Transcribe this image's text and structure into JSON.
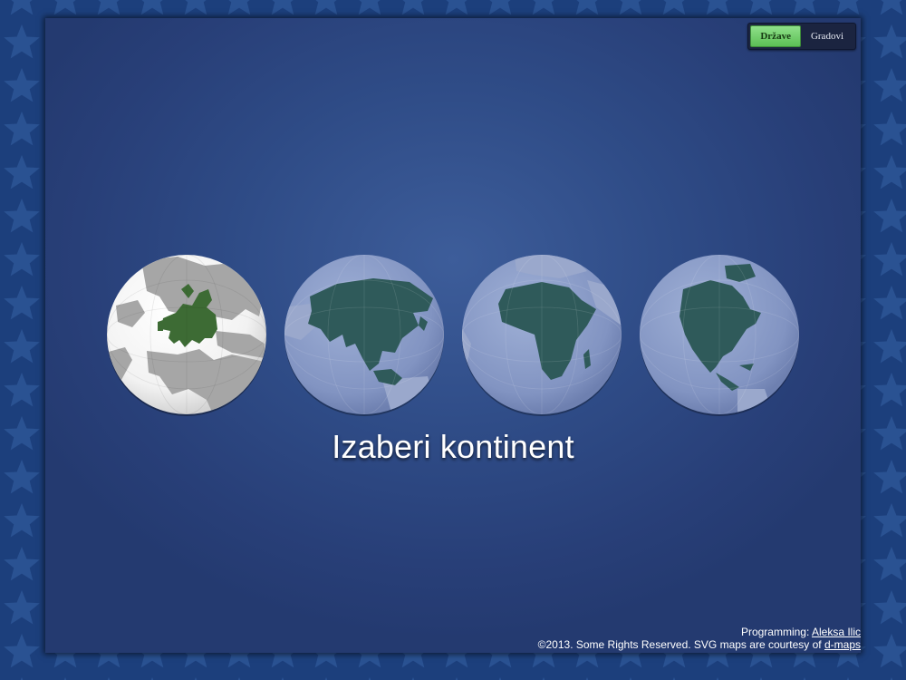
{
  "toggle": {
    "countries_label": "Države",
    "cities_label": "Gradovi",
    "active": "countries"
  },
  "continents": [
    {
      "id": "europe",
      "icon": "europe-globe-icon",
      "highlighted": true
    },
    {
      "id": "asia",
      "icon": "asia-globe-icon",
      "highlighted": false
    },
    {
      "id": "africa",
      "icon": "africa-globe-icon",
      "highlighted": false
    },
    {
      "id": "north-america",
      "icon": "north-america-globe-icon",
      "highlighted": false
    }
  ],
  "main": {
    "title": "Izaberi kontinent"
  },
  "footer": {
    "programming_prefix": "Programming: ",
    "author_link": "Aleksa Ilic",
    "copyright_text": "©2013. Some Rights Reserved. SVG maps are courtesy of ",
    "maps_link": "d-maps"
  },
  "colors": {
    "background": "#1c3f7c",
    "panel": "#2f4c87",
    "active_toggle": "#5cbf55",
    "europe_highlight": "#3d6b34",
    "continent_dark": "#2f5a5a",
    "globe_face": "#8b9cc7"
  }
}
